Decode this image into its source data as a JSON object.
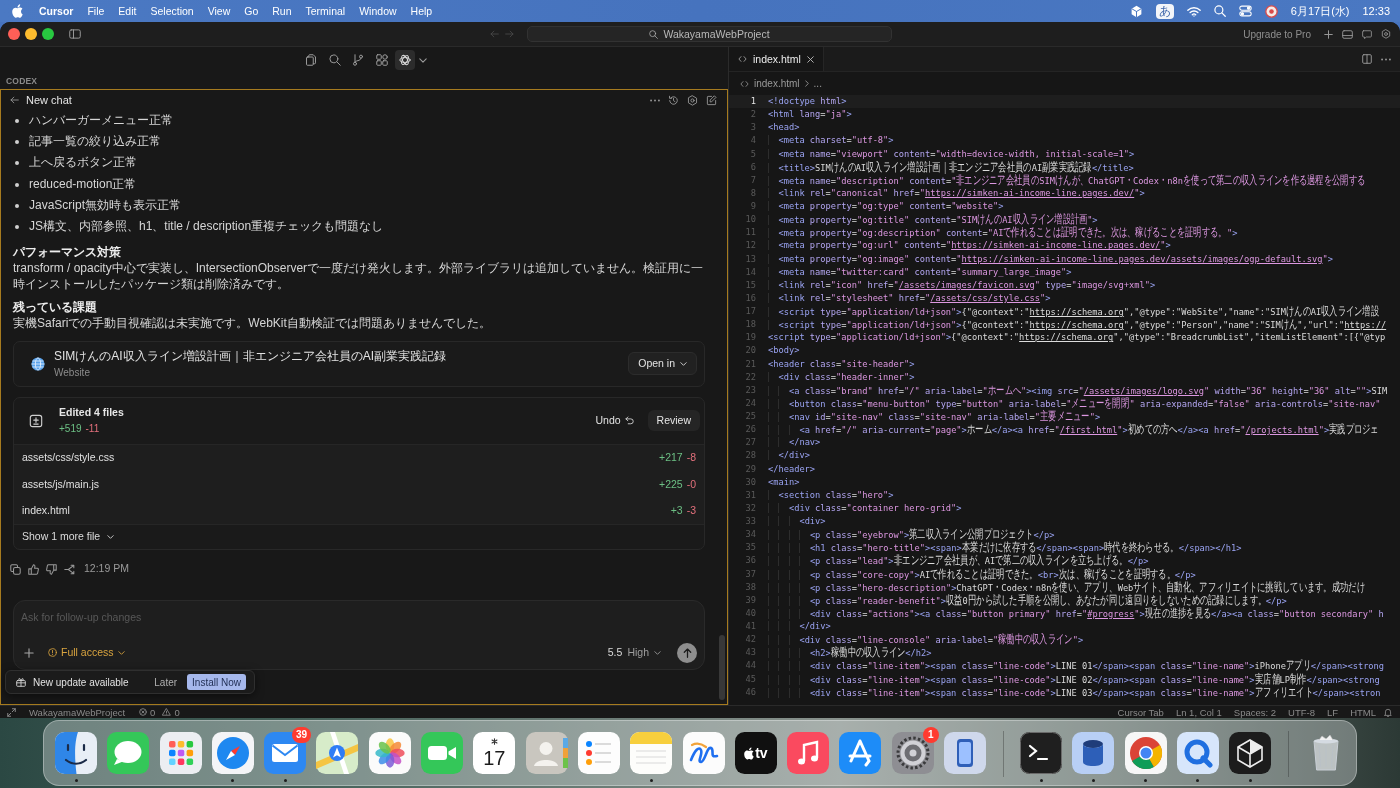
{
  "menu_bar": {
    "app_name": "Cursor",
    "menus": [
      "File",
      "Edit",
      "Selection",
      "View",
      "Go",
      "Run",
      "Terminal",
      "Window",
      "Help"
    ],
    "input_mode": "あ",
    "date": "6月17日(水)",
    "time": "12:33"
  },
  "title_bar": {
    "search": "WakayamaWebProject",
    "upgrade": "Upgrade to Pro"
  },
  "codex_panel": {
    "toolbar": [
      {
        "kind": "files",
        "selected": false
      },
      {
        "kind": "search",
        "selected": false
      },
      {
        "kind": "branch",
        "selected": false
      },
      {
        "kind": "extensions",
        "selected": false
      },
      {
        "kind": "agent",
        "selected": true
      }
    ],
    "section_label": "CODEX",
    "chat_title": "New chat",
    "bullets": [
      "ハンバーガーメニュー正常",
      "記事一覧の絞り込み正常",
      "上へ戻るボタン正常",
      "reduced-motion正常",
      "JavaScript無効時も表示正常",
      "JS構文、内部参照、h1、title / description重複チェックも問題なし"
    ],
    "sections": [
      {
        "heading": "パフォーマンス対策",
        "text": "transform / opacity中心で実装し、IntersectionObserverで一度だけ発火します。外部ライブラリは追加していません。検証用に一時インストールしたパッケージ類は削除済みです。"
      },
      {
        "heading": "残っている課題",
        "text": "実機Safariでの手動目視確認は未実施です。WebKit自動検証では問題ありませんでした。"
      }
    ],
    "link_card": {
      "title": "SIMけんのAI収入ライン増設計画｜非エンジニア会社員のAI副業実践記録",
      "subtitle": "Website",
      "button": "Open in"
    },
    "edits": {
      "title": "Edited 4 files",
      "added": "+519",
      "removed": "-11",
      "undo": "Undo",
      "review": "Review",
      "files": [
        {
          "path": "assets/css/style.css",
          "added": "+217",
          "removed": "-8"
        },
        {
          "path": "assets/js/main.js",
          "added": "+225",
          "removed": "-0"
        },
        {
          "path": "index.html",
          "added": "+3",
          "removed": "-3"
        }
      ],
      "more": "Show 1 more file"
    },
    "message_time": "12:19 PM",
    "composer": {
      "placeholder": "Ask for follow-up changes",
      "access": "Full access",
      "model": "5.5",
      "effort": "High"
    },
    "toast": {
      "text": "New update available",
      "later": "Later",
      "install": "Install Now"
    }
  },
  "editor": {
    "tabs": [
      {
        "label": "index.html",
        "selected": true
      }
    ],
    "breadcrumb": [
      "index.html",
      "..."
    ],
    "lines": [
      {
        "number": "1",
        "code": "<!doctype html>",
        "current": true
      },
      {
        "number": "2",
        "code": "<html lang=\"ja\">",
        "current": false
      },
      {
        "number": "3",
        "code": "<head>",
        "current": false
      },
      {
        "number": "4",
        "code": "  <meta charset=\"utf-8\">",
        "current": false
      },
      {
        "number": "5",
        "code": "  <meta name=\"viewport\" content=\"width=device-width, initial-scale=1\">",
        "current": false
      },
      {
        "number": "6",
        "code": "  <title>SIMけんのAI収入ライン増設計画｜非エンジニア会社員のAI副業実践記録</title>",
        "current": false
      },
      {
        "number": "7",
        "code": "  <meta name=\"description\" content=\"非エンジニア会社員のSIMけんが、ChatGPT・Codex・n8nを使って第二の収入ラインを作る過程を公開する",
        "current": false
      },
      {
        "number": "8",
        "code": "  <link rel=\"canonical\" href=\"https://simken-ai-income-line.pages.dev/\">",
        "current": false
      },
      {
        "number": "9",
        "code": "  <meta property=\"og:type\" content=\"website\">",
        "current": false
      },
      {
        "number": "10",
        "code": "  <meta property=\"og:title\" content=\"SIMけんのAI収入ライン増設計画\">",
        "current": false
      },
      {
        "number": "11",
        "code": "  <meta property=\"og:description\" content=\"AIで作れることは証明できた。次は、稼げることを証明する。\">",
        "current": false
      },
      {
        "number": "12",
        "code": "  <meta property=\"og:url\" content=\"https://simken-ai-income-line.pages.dev/\">",
        "current": false
      },
      {
        "number": "13",
        "code": "  <meta property=\"og:image\" content=\"https://simken-ai-income-line.pages.dev/assets/images/ogp-default.svg\">",
        "current": false
      },
      {
        "number": "14",
        "code": "  <meta name=\"twitter:card\" content=\"summary_large_image\">",
        "current": false
      },
      {
        "number": "15",
        "code": "  <link rel=\"icon\" href=\"/assets/images/favicon.svg\" type=\"image/svg+xml\">",
        "current": false
      },
      {
        "number": "16",
        "code": "  <link rel=\"stylesheet\" href=\"/assets/css/style.css\">",
        "current": false
      },
      {
        "number": "17",
        "code": "  <script type=\"application/ld+json\">{\"@context\":\"https://schema.org\",\"@type\":\"WebSite\",\"name\":\"SIMけんのAI収入ライン増設",
        "current": false
      },
      {
        "number": "18",
        "code": "  <script type=\"application/ld+json\">{\"@context\":\"https://schema.org\",\"@type\":\"Person\",\"name\":\"SIMけん\",\"url\":\"https://",
        "current": false
      },
      {
        "number": "19",
        "code": "<script type=\"application/ld+json\">{\"@context\":\"https://schema.org\",\"@type\":\"BreadcrumbList\",\"itemListElement\":[{\"@typ",
        "current": false
      },
      {
        "number": "20",
        "code": "<body>",
        "current": false
      },
      {
        "number": "21",
        "code": "<header class=\"site-header\">",
        "current": false
      },
      {
        "number": "22",
        "code": "  <div class=\"header-inner\">",
        "current": false
      },
      {
        "number": "23",
        "code": "    <a class=\"brand\" href=\"/\" aria-label=\"ホームへ\"><img src=\"/assets/images/logo.svg\" width=\"36\" height=\"36\" alt=\"\">SIM",
        "current": false
      },
      {
        "number": "24",
        "code": "    <button class=\"menu-button\" type=\"button\" aria-label=\"メニューを開閉\" aria-expanded=\"false\" aria-controls=\"site-nav\"",
        "current": false
      },
      {
        "number": "25",
        "code": "    <nav id=\"site-nav\" class=\"site-nav\" aria-label=\"主要メニュー\">",
        "current": false
      },
      {
        "number": "26",
        "code": "      <a href=\"/\" aria-current=\"page\">ホーム</a><a href=\"/first.html\">初めての方へ</a><a href=\"/projects.html\">実践プロジェ",
        "current": false
      },
      {
        "number": "27",
        "code": "    </nav>",
        "current": false
      },
      {
        "number": "28",
        "code": "  </div>",
        "current": false
      },
      {
        "number": "29",
        "code": "</header>",
        "current": false
      },
      {
        "number": "30",
        "code": "<main>",
        "current": false
      },
      {
        "number": "31",
        "code": "  <section class=\"hero\">",
        "current": false
      },
      {
        "number": "32",
        "code": "    <div class=\"container hero-grid\">",
        "current": false
      },
      {
        "number": "33",
        "code": "      <div>",
        "current": false
      },
      {
        "number": "34",
        "code": "        <p class=\"eyebrow\">第二収入ライン公開プロジェクト</p>",
        "current": false
      },
      {
        "number": "35",
        "code": "        <h1 class=\"hero-title\"><span>本業だけに依存する</span><span>時代を終わらせる。</span></h1>",
        "current": false
      },
      {
        "number": "36",
        "code": "        <p class=\"lead\">非エンジニア会社員が、AIで第二の収入ラインを立ち上げる。</p>",
        "current": false
      },
      {
        "number": "37",
        "code": "        <p class=\"core-copy\">AIで作れることは証明できた。<br>次は、稼げることを証明する。</p>",
        "current": false
      },
      {
        "number": "38",
        "code": "        <p class=\"hero-description\">ChatGPT・Codex・n8nを使い、アプリ、Webサイト、自動化、アフィリエイトに挑戦しています。成功だけ",
        "current": false
      },
      {
        "number": "39",
        "code": "        <p class=\"reader-benefit\">収益0円から試した手順を公開し、あなたが同じ遠回りをしないための記録にします。</p>",
        "current": false
      },
      {
        "number": "40",
        "code": "        <div class=\"actions\"><a class=\"button primary\" href=\"#progress\">現在の進捗を見る</a><a class=\"button secondary\" h",
        "current": false
      },
      {
        "number": "41",
        "code": "      </div>",
        "current": false
      },
      {
        "number": "42",
        "code": "      <div class=\"line-console\" aria-label=\"稼働中の収入ライン\">",
        "current": false
      },
      {
        "number": "43",
        "code": "        <h2>稼働中の収入ライン</h2>",
        "current": false
      },
      {
        "number": "44",
        "code": "        <div class=\"line-item\"><span class=\"line-code\">LINE 01</span><span class=\"line-name\">iPhoneアプリ</span><strong",
        "current": false
      },
      {
        "number": "45",
        "code": "        <div class=\"line-item\"><span class=\"line-code\">LINE 02</span><span class=\"line-name\">実店舗LP制作</span><strong",
        "current": false
      },
      {
        "number": "46",
        "code": "        <div class=\"line-item\"><span class=\"line-code\">LINE 03</span><span class=\"line-name\">アフィリエイト</span><stron",
        "current": false
      }
    ]
  },
  "status_bar": {
    "project": "WakayamaWebProject",
    "errors": "0",
    "warnings": "0",
    "items": [
      "Cursor Tab",
      "Ln 1, Col 1",
      "Spaces: 2",
      "UTF-8",
      "LF",
      "HTML"
    ]
  },
  "dock": {
    "apps": [
      {
        "kind": "finder",
        "running": true
      },
      {
        "kind": "messages",
        "running": false
      },
      {
        "kind": "launchpad",
        "running": false
      },
      {
        "kind": "safari",
        "running": true
      },
      {
        "kind": "mail",
        "running": true,
        "badge": "39"
      },
      {
        "kind": "maps",
        "running": false
      },
      {
        "kind": "photos",
        "running": false
      },
      {
        "kind": "facetime",
        "running": false
      },
      {
        "kind": "calendar",
        "running": false,
        "label": "17"
      },
      {
        "kind": "contacts",
        "running": false
      },
      {
        "kind": "reminders",
        "running": false
      },
      {
        "kind": "notes",
        "running": true
      },
      {
        "kind": "freeform",
        "running": false
      },
      {
        "kind": "tv",
        "running": false,
        "label": "tv"
      },
      {
        "kind": "music",
        "running": false
      },
      {
        "kind": "app_store",
        "running": false
      },
      {
        "kind": "settings",
        "running": false,
        "badge": "1"
      },
      {
        "kind": "mirroring",
        "running": false
      }
    ],
    "recent_apps": [
      {
        "kind": "terminal",
        "running": true
      },
      {
        "kind": "database",
        "running": true
      },
      {
        "kind": "browser",
        "running": true
      },
      {
        "kind": "q",
        "running": true
      },
      {
        "kind": "cube",
        "running": true
      }
    ]
  }
}
